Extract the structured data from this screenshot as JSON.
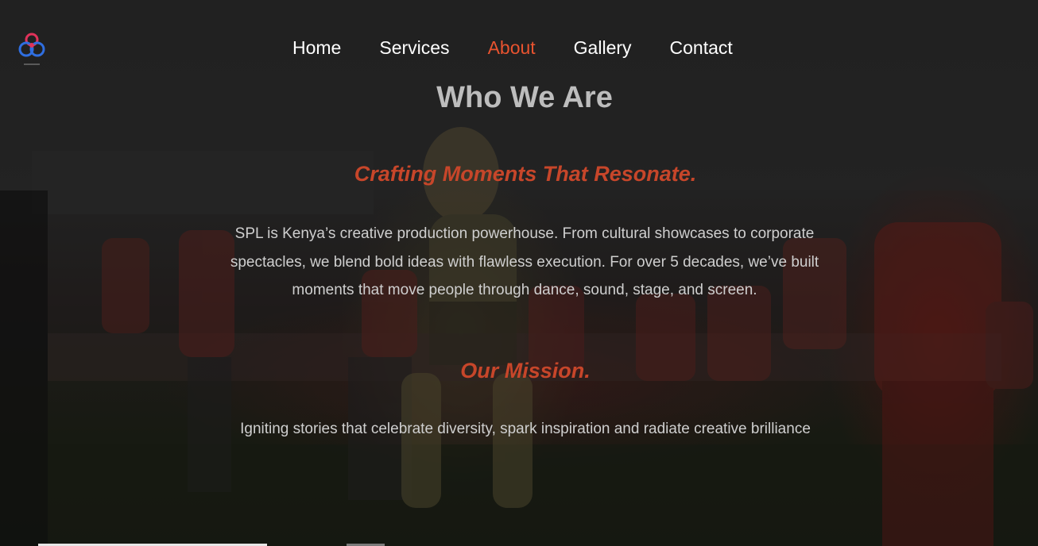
{
  "brand": {
    "logo_icon": "spl-interlocking-rings-logo",
    "colors": {
      "accent": "#e8532f",
      "heading": "#bdbdbd",
      "body_text": "#cfcfcf",
      "subheading": "#c7462a"
    }
  },
  "nav": {
    "items": [
      {
        "label": "Home",
        "active": false
      },
      {
        "label": "Services",
        "active": false
      },
      {
        "label": "About",
        "active": true
      },
      {
        "label": "Gallery",
        "active": false
      },
      {
        "label": "Contact",
        "active": false
      }
    ]
  },
  "about": {
    "title": "Who We Are",
    "tagline": "Crafting Moments That Resonate.",
    "intro": "SPL is Kenya’s creative production powerhouse. From cultural showcases to corporate spectacles, we blend bold ideas with flawless execution. For over 5 decades, we’ve built moments that move people through dance, sound, stage, and screen.",
    "mission_heading": "Our Mission.",
    "mission_text": "Igniting stories that celebrate diversity, spark inspiration and radiate creative brilliance"
  }
}
